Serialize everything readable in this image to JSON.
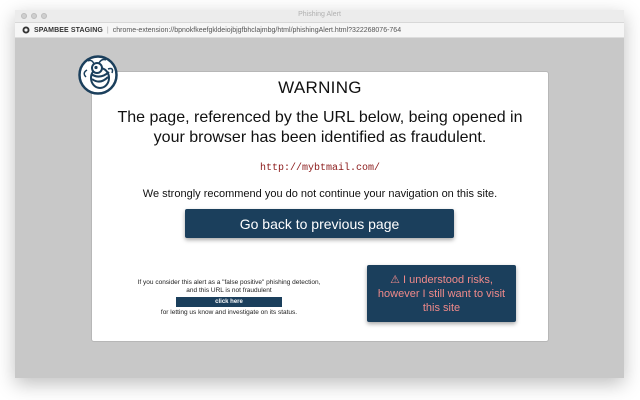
{
  "window": {
    "title": "Phishing Alert"
  },
  "urlbar": {
    "extension_name": "SPAMBEE STAGING",
    "separator": "|",
    "url": "chrome-extension://bpnokfkeefgkldeiojbjgfbhclajmbg/html/phishingAlert.html?32226807​6-764"
  },
  "alert": {
    "heading": "WARNING",
    "message": "The page, referenced by the URL below, being opened in your browser has been identified as fraudulent.",
    "flagged_url": "http://mybtmail.com/",
    "recommendation": "We strongly recommend you do not continue your navigation on this site.",
    "back_button_label": "Go back to previous page",
    "false_positive": {
      "line1": "If you consider this alert as a \"false positive\" phishing detection,",
      "line2": "and this URL is not fraudulent",
      "button_label": "click here",
      "line3": "for letting us know and investigate on its status."
    },
    "risk_button": {
      "icon": "⚠",
      "label": "I understood risks, however I still want to visit this site"
    }
  },
  "colors": {
    "button_bg": "#1b3f5c",
    "risk_text": "#f08a8a",
    "url_text": "#8b1a1a",
    "backdrop": "#c8c8c8"
  },
  "icons": {
    "logo": "spambee-bee-logo",
    "extension": "spambee-small-icon",
    "warning": "warning-triangle-icon"
  }
}
